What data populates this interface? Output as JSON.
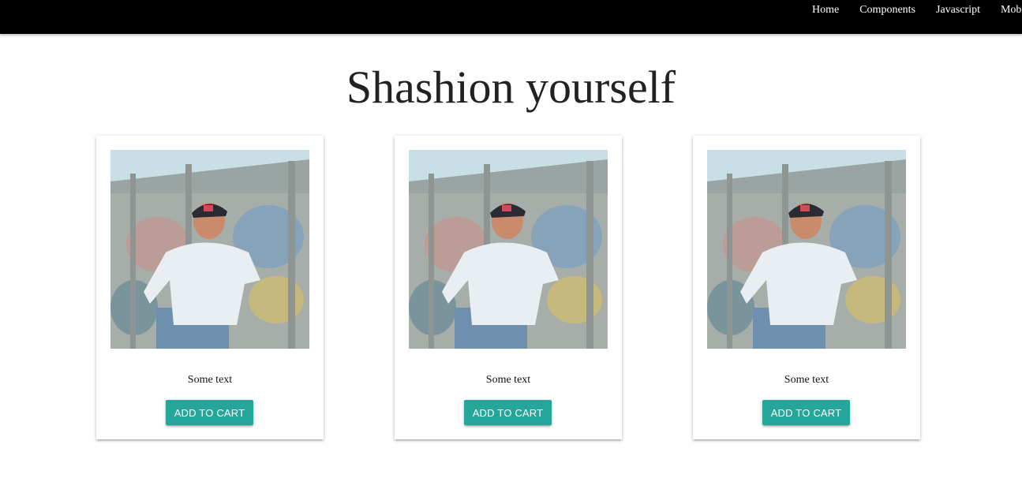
{
  "navbar": {
    "links": [
      "Home",
      "Components",
      "Javascript",
      "Mobi"
    ]
  },
  "page": {
    "title": "Shashion yourself"
  },
  "cards": [
    {
      "text": "Some text",
      "button": "ADD TO CART"
    },
    {
      "text": "Some text",
      "button": "ADD TO CART"
    },
    {
      "text": "Some text",
      "button": "ADD TO CART"
    }
  ],
  "colors": {
    "navbar_bg": "#000000",
    "button_bg": "#26a69a",
    "title": "#222222"
  }
}
